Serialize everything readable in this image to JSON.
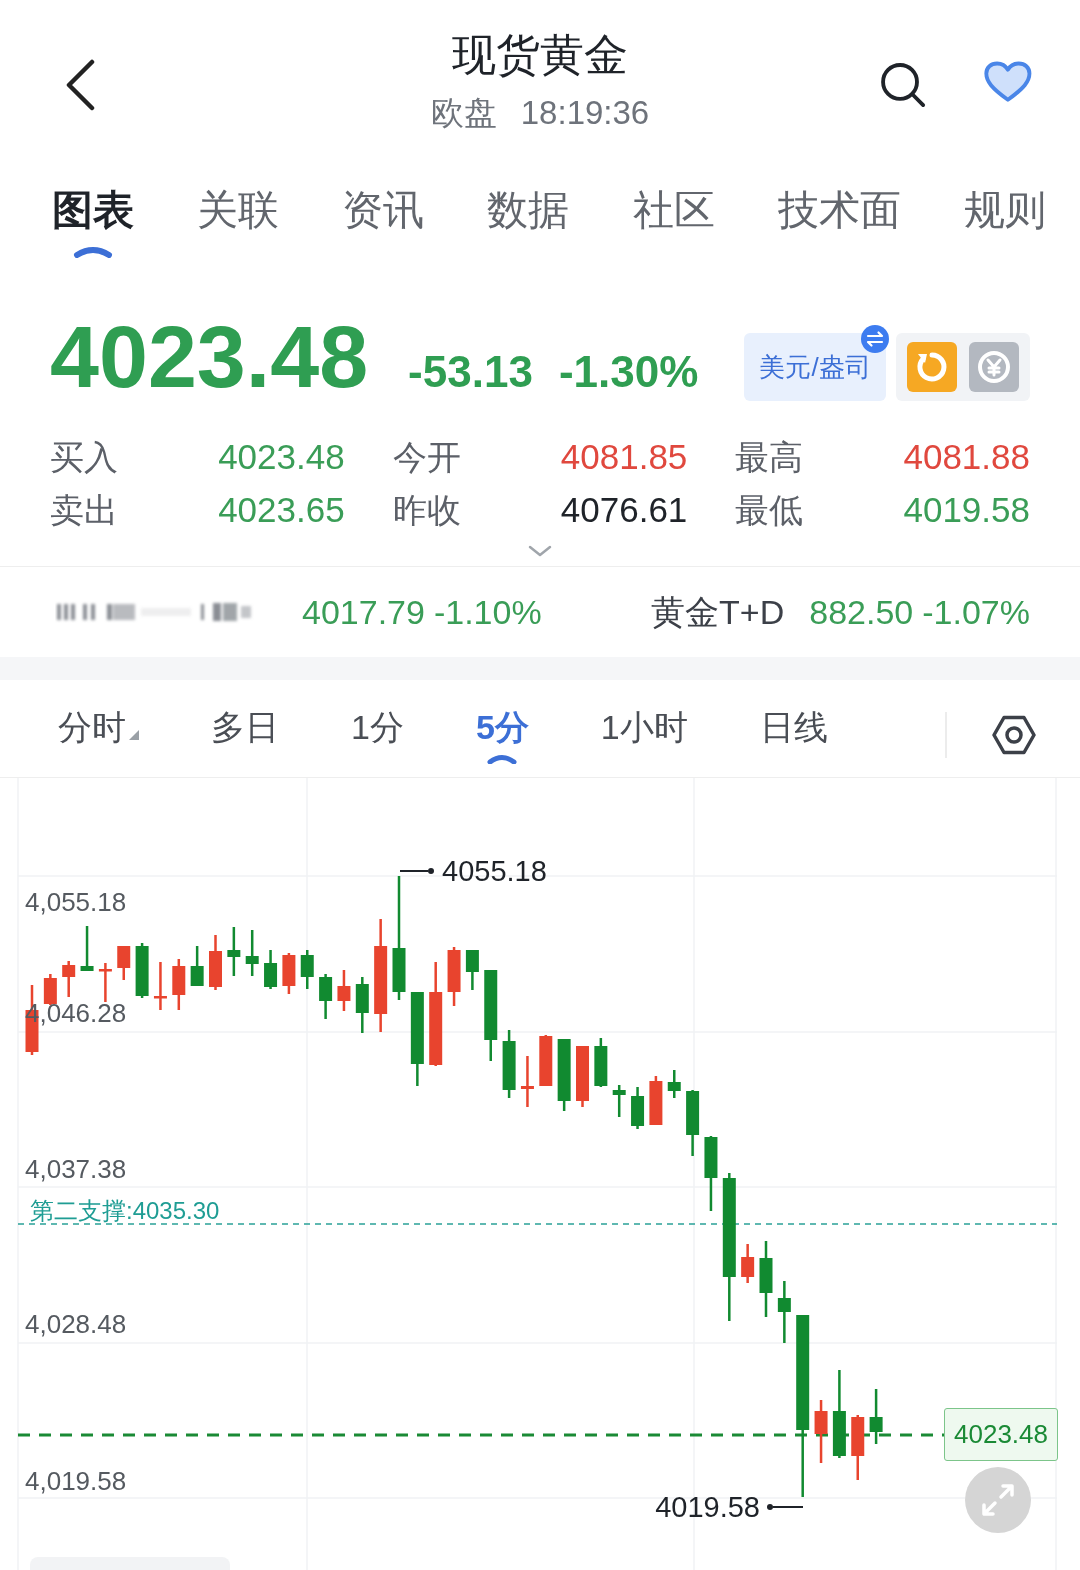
{
  "header": {
    "title": "现货黄金",
    "session": "欧盘",
    "time": "18:19:36"
  },
  "tabs": [
    {
      "label": "图表",
      "selected": true
    },
    {
      "label": "关联",
      "selected": false
    },
    {
      "label": "资讯",
      "selected": false
    },
    {
      "label": "数据",
      "selected": false
    },
    {
      "label": "社区",
      "selected": false
    },
    {
      "label": "技术面",
      "selected": false
    },
    {
      "label": "规则",
      "selected": false
    }
  ],
  "quote": {
    "price": "4023.48",
    "change": "-53.13",
    "change_percent": "-1.30%",
    "unit_button": "美元/盎司"
  },
  "stats": [
    {
      "label": "买入",
      "value": "4023.48",
      "color": "#3a9d57"
    },
    {
      "label": "今开",
      "value": "4081.85",
      "color": "#e0483e"
    },
    {
      "label": "最高",
      "value": "4081.88",
      "color": "#e0483e"
    },
    {
      "label": "卖出",
      "value": "4023.65",
      "color": "#3a9d57"
    },
    {
      "label": "昨收",
      "value": "4076.61",
      "color": "#1f2329"
    },
    {
      "label": "最低",
      "value": "4019.58",
      "color": "#3a9d57"
    }
  ],
  "related": [
    {
      "kind": "blurred",
      "price": "4017.79",
      "change": "-1.10%"
    },
    {
      "kind": "named",
      "name": "黄金T+D",
      "price": "882.50",
      "change": "-1.07%"
    }
  ],
  "periods": [
    {
      "label": "分时",
      "selected": false,
      "has_menu": true
    },
    {
      "label": "多日",
      "selected": false,
      "has_menu": false
    },
    {
      "label": "1分",
      "selected": false,
      "has_menu": false
    },
    {
      "label": "5分",
      "selected": true,
      "has_menu": false
    },
    {
      "label": "1小时",
      "selected": false,
      "has_menu": false
    },
    {
      "label": "日线",
      "selected": false,
      "has_menu": false
    }
  ],
  "chart": {
    "y_labels": [
      "4,055.18",
      "4,046.28",
      "4,037.38",
      "4,028.48",
      "4,019.58"
    ],
    "high_marker": "4055.18",
    "low_marker": "4019.58",
    "support_label": "第二支撑:4035.30",
    "last_price": "4023.48"
  }
}
